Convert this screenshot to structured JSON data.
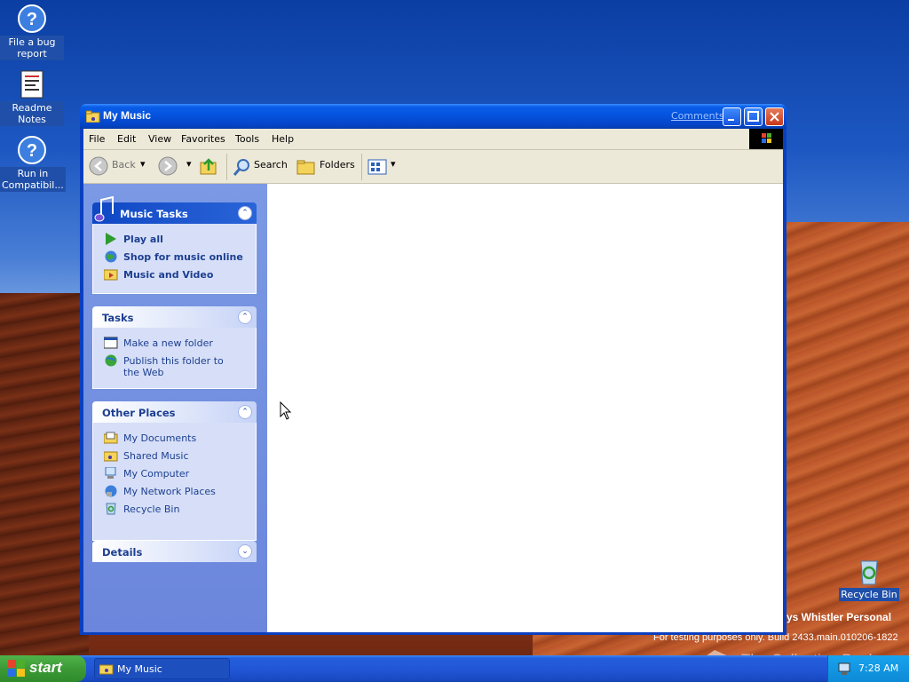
{
  "desktop": {
    "icons": [
      {
        "label": "File a bug report"
      },
      {
        "label": "Readme Notes"
      },
      {
        "label": "Run in Compatibil..."
      },
      {
        "label": "Recycle Bin"
      }
    ],
    "build_line1": "ys Whistler Personal",
    "build_line2": "For testing purposes only. Build 2433.main.010206-1822",
    "watermark": "The Collection Book"
  },
  "window": {
    "title": "My Music",
    "comments_link": "Comments?",
    "menus": [
      "File",
      "Edit",
      "View",
      "Favorites",
      "Tools",
      "Help"
    ],
    "toolbar": {
      "back": "Back",
      "search": "Search",
      "folders": "Folders"
    },
    "panels": {
      "music_tasks": {
        "title": "Music Tasks",
        "items": [
          "Play all",
          "Shop for music online",
          "Music and Video"
        ]
      },
      "tasks": {
        "title": "Tasks",
        "items": [
          "Make a new folder",
          "Publish this folder to the Web"
        ]
      },
      "other_places": {
        "title": "Other Places",
        "items": [
          "My Documents",
          "Shared Music",
          "My Computer",
          "My Network Places",
          "Recycle Bin"
        ]
      },
      "details": {
        "title": "Details"
      }
    }
  },
  "taskbar": {
    "start_label": "start",
    "task_label": "My Music",
    "clock": "7:28 AM"
  },
  "colors": {
    "titlebar": "#0551dc",
    "leftpane": "#7b99e4",
    "taskbar": "#245edb",
    "start": "#3c9a36"
  }
}
